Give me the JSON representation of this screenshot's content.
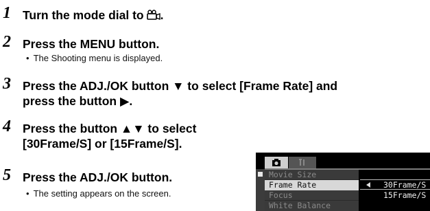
{
  "steps": [
    {
      "number": "1",
      "title": "Turn the mode dial to",
      "suffix": ".",
      "icon": "movie-camera-icon"
    },
    {
      "number": "2",
      "title": "Press the MENU button.",
      "sub": "The Shooting menu is displayed."
    },
    {
      "number": "3",
      "title_line1": "Press the ADJ./OK button ▼ to select [Frame Rate] and",
      "title_line2": "press the button ▶."
    },
    {
      "number": "4",
      "title_line1": "Press the button ▲▼ to select",
      "title_line2": "[30Frame/S] or [15Frame/S]."
    },
    {
      "number": "5",
      "title": "Press the ADJ./OK button.",
      "sub": "The setting appears on the screen."
    }
  ],
  "bullet": "•",
  "lcd_menu": {
    "tabs": [
      {
        "icon": "camera-icon"
      },
      {
        "icon": "wrench-icon"
      }
    ],
    "items": [
      {
        "label": "Movie Size"
      },
      {
        "label": "Frame Rate"
      },
      {
        "label": "Focus"
      },
      {
        "label": "White Balance"
      }
    ],
    "selected_index": 1,
    "options": [
      {
        "label": "30Frame/S"
      },
      {
        "label": "15Frame/S"
      }
    ],
    "selected_option_index": 0
  }
}
